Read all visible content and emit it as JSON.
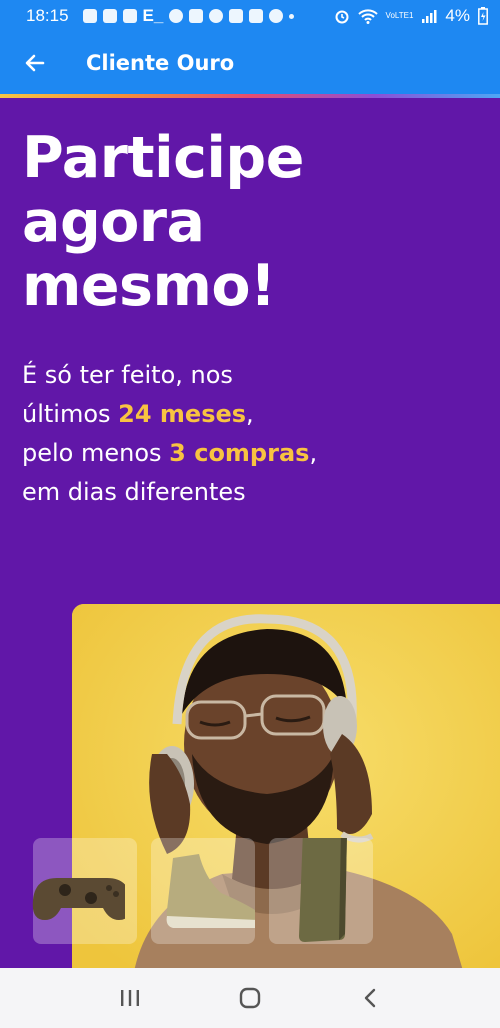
{
  "status_bar": {
    "time": "18:15",
    "notif_text": "E_",
    "volte_label": "VoLTE1",
    "battery": "4%"
  },
  "app_bar": {
    "title": "Cliente Ouro",
    "back_icon": "arrow-left-icon"
  },
  "content": {
    "headline": [
      "Participe",
      "agora",
      "mesmo!"
    ],
    "subtext": {
      "line1": "É só ter feito, nos",
      "line2_prefix": "últimos ",
      "line2_highlight": "24 meses",
      "line2_suffix": ",",
      "line3_prefix": "pelo menos ",
      "line3_highlight": "3 compras",
      "line3_suffix": ",",
      "line4": "em dias diferentes"
    },
    "highlight_color": "#f8c341",
    "background_color": "#6117a8",
    "photo_card_color": "#f3d351",
    "thumbnails": [
      "game-controller-icon",
      "sneaker-icon",
      "smartphone-icon"
    ]
  },
  "nav_bar": {
    "recents_icon": "recents-icon",
    "home_icon": "home-icon",
    "back_icon": "back-chevron-icon"
  }
}
